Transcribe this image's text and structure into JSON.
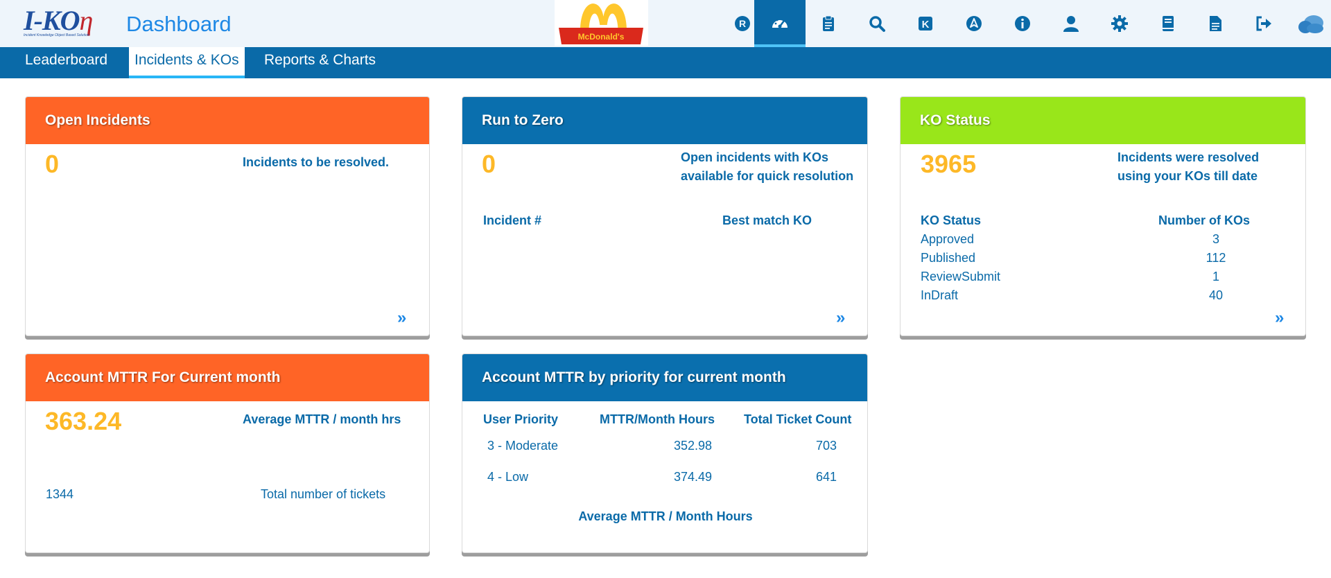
{
  "header": {
    "logo_text": "I-KO",
    "logo_eta": "η",
    "logo_tagline": "Incident Knowledge Object Based Solution",
    "title": "Dashboard",
    "brand_logo": "McDonald's",
    "nav_icons": [
      "registered-icon",
      "dashboard-gauge-icon",
      "clipboard-icon",
      "search-icon",
      "k-icon",
      "navigation-icon",
      "info-icon",
      "user-icon",
      "gear-icon",
      "book-icon",
      "document-icon",
      "sign-out-icon",
      "cloud-icon"
    ]
  },
  "tabs": [
    {
      "label": "Leaderboard",
      "active": false
    },
    {
      "label": "Incidents & KOs",
      "active": true
    },
    {
      "label": "Reports & Charts",
      "active": false
    }
  ],
  "open_incidents": {
    "title": "Open Incidents",
    "count": "0",
    "description": "Incidents to be resolved.",
    "more": "»"
  },
  "run_to_zero": {
    "title": "Run to Zero",
    "count": "0",
    "description_line1": "Open incidents with KOs",
    "description_line2": "available for quick resolution",
    "col_incident": "Incident #",
    "col_best_match": "Best match KO",
    "more": "»"
  },
  "ko_status": {
    "title": "KO Status",
    "count": "3965",
    "description_line1": "Incidents were resolved",
    "description_line2": "using your KOs till date",
    "col_status": "KO Status",
    "col_number": "Number of KOs",
    "rows": [
      {
        "status": "Approved",
        "number": "3"
      },
      {
        "status": "Published",
        "number": "112"
      },
      {
        "status": "ReviewSubmit",
        "number": "1"
      },
      {
        "status": "InDraft",
        "number": "40"
      }
    ],
    "more": "»"
  },
  "account_mttr": {
    "title": "Account MTTR For Current month",
    "value": "363.24",
    "value_label": "Average MTTR / month hrs",
    "tickets": "1344",
    "tickets_label": "Total number of tickets"
  },
  "mttr_priority": {
    "title": "Account MTTR by priority for current month",
    "col_priority": "User Priority",
    "col_mttr": "MTTR/Month Hours",
    "col_count": "Total Ticket Count",
    "rows": [
      {
        "priority": "3 - Moderate",
        "mttr": "352.98",
        "count": "703"
      },
      {
        "priority": "4 - Low",
        "mttr": "374.49",
        "count": "641"
      }
    ],
    "footer": "Average MTTR / Month Hours"
  },
  "colors": {
    "primary": "#0a6aa8",
    "orange": "#ff6426",
    "green": "#99e61a",
    "highlight": "#fdb827"
  }
}
